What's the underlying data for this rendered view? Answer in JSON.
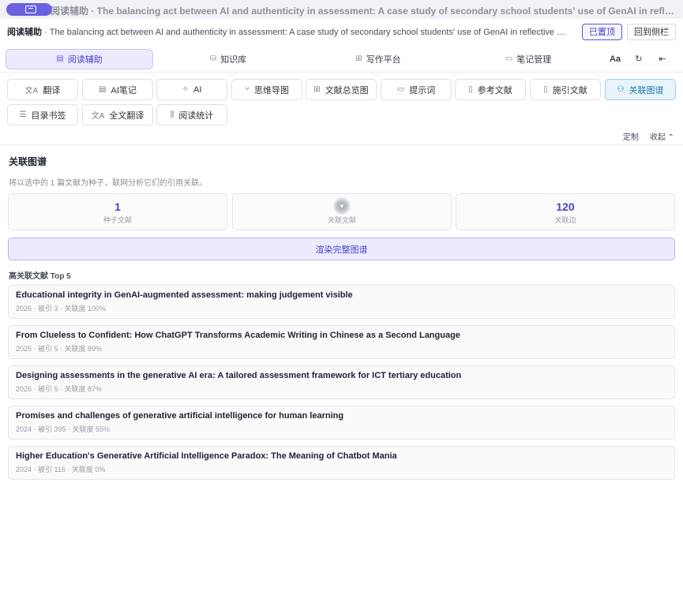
{
  "titlebar": {
    "title": "阅读辅助 · The balancing act between AI and authenticity in assessment: A case study of secondary school students' use of GenAI in reflective wr..."
  },
  "docbar": {
    "label": "阅读辅助",
    "title": " · The balancing act between AI and authenticity in assessment: A case study of secondary school students' use of GenAI in reflective writing",
    "pin_label": "已置顶",
    "back_label": "回到侧栏"
  },
  "navtabs": [
    {
      "label": "阅读辅助",
      "icon": "document-icon"
    },
    {
      "label": "知识库",
      "icon": "database-icon"
    },
    {
      "label": "写作平台",
      "icon": "grid-icon"
    },
    {
      "label": "笔记管理",
      "icon": "folder-icon"
    }
  ],
  "navtools": {
    "font": "Aa",
    "refresh": "↻",
    "collapse": "⇤"
  },
  "tools": [
    {
      "label": "翻译",
      "icon": "translate-icon",
      "glyph": "文A"
    },
    {
      "label": "AI笔记",
      "icon": "note-icon",
      "glyph": "▤"
    },
    {
      "label": "AI",
      "icon": "sparkle-icon",
      "glyph": "✧"
    },
    {
      "label": "思维导图",
      "icon": "mindmap-icon",
      "glyph": "⑂"
    },
    {
      "label": "文献总览图",
      "icon": "grid-icon",
      "glyph": "⊞"
    },
    {
      "label": "提示词",
      "icon": "chat-icon",
      "glyph": "▭"
    },
    {
      "label": "参考文献",
      "icon": "file-icon",
      "glyph": "▯"
    },
    {
      "label": "施引文献",
      "icon": "file-icon",
      "glyph": "▯"
    },
    {
      "label": "关联图谱",
      "icon": "graph-icon",
      "glyph": "⚇"
    },
    {
      "label": "目录书签",
      "icon": "list-icon",
      "glyph": "☰"
    },
    {
      "label": "全文翻译",
      "icon": "translate-icon",
      "glyph": "文A"
    },
    {
      "label": "阅读统计",
      "icon": "chart-icon",
      "glyph": "⫼"
    }
  ],
  "panel_controls": {
    "customize": "定制",
    "collapse": "收起"
  },
  "panel": {
    "title": "关联图谱",
    "description": "将以选中的 1 篇文献为种子，联网分析它们的引用关联。",
    "stats": [
      {
        "value": "1",
        "label": "种子文献"
      },
      {
        "value": "",
        "label": "关联文献"
      },
      {
        "value": "120",
        "label": "关联边"
      }
    ],
    "render_button": "渲染完整图谱",
    "top_title": "高关联文献 Top 5",
    "references": [
      {
        "title": "Educational integrity in GenAI-augmented assessment: making judgement visible",
        "meta": "2026 · 被引 3 · 关联度 100%"
      },
      {
        "title": "From Clueless to Confident: How ChatGPT Transforms Academic Writing in Chinese as a Second Language",
        "meta": "2025 · 被引 5 · 关联度 89%"
      },
      {
        "title": "Designing assessments in the generative AI era: A tailored assessment framework for ICT tertiary education",
        "meta": "2026 · 被引 5 · 关联度 87%"
      },
      {
        "title": "Promises and challenges of generative artificial intelligence for human learning",
        "meta": "2024 · 被引 395 · 关联度 55%"
      },
      {
        "title": "Higher Education's Generative Artificial Intelligence Paradox: The Meaning of Chatbot Mania",
        "meta": "2024 · 被引 116 · 关联度 0%"
      }
    ]
  },
  "colors": {
    "accent": "#6b62e0",
    "active_tool": "#2578a8"
  }
}
